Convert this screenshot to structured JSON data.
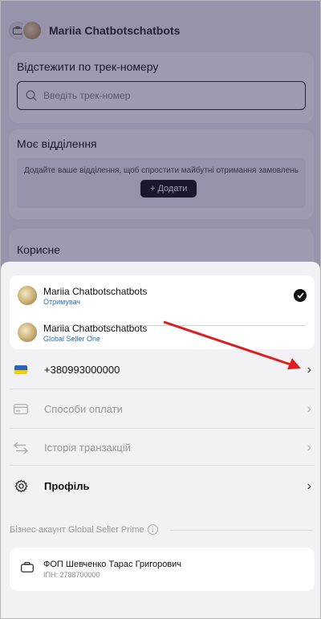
{
  "background": {
    "user_name": "Mariia Chatbotschatbots",
    "track": {
      "title": "Відстежити по трек-номеру",
      "placeholder": "Введіть трек-номер"
    },
    "branch": {
      "title": "Моє відділення",
      "message": "Додайте ваше відділення, щоб спростити майбутні отримання замовлень",
      "add_button": "+ Додати"
    },
    "useful": {
      "title": "Корисне"
    }
  },
  "accounts": [
    {
      "name": "Mariia Chatbotschatbots",
      "role": "Отримувач",
      "selected": true
    },
    {
      "name": "Mariia Chatbotschatbots",
      "role": "Global Seller One",
      "selected": false
    }
  ],
  "menu": {
    "phone": "+380993000000",
    "payment_methods": "Способи оплати",
    "transaction_history": "Історія транзакцій",
    "profile": "Профіль"
  },
  "business": {
    "section_title": "Бізнес-акаунт Global Seller Prime",
    "name": "ФОП Шевченко Тарас Григорович",
    "tax_id": "ІПН: 2788700000"
  },
  "colors": {
    "accent_link": "#2a6fb5",
    "annotation_arrow": "#e01b1b",
    "flag_blue": "#2a63c7",
    "flag_yellow": "#f5d000"
  }
}
